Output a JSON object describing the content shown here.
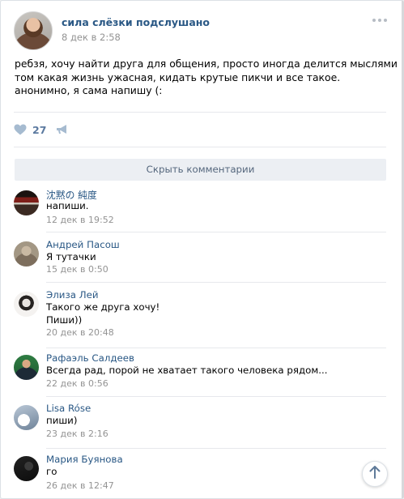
{
  "post": {
    "group_name": "сила слёзки подслушано",
    "date": "8 дек в 2:58",
    "text_lines": [
      "ребзя, хочу найти друга для общения, просто иногда делится мыслями и ныть о",
      "том какая жизнь ужасная, кидать крутые пикчи и все такое.",
      "анонимно, я сама напишу (:"
    ],
    "likes": "27"
  },
  "hide_comments_label": "Скрыть комментарии",
  "comments": [
    {
      "author": "沈黙の 純度",
      "lines": [
        "напиши."
      ],
      "date": "12 дек в 19:52"
    },
    {
      "author": "Андрей Пасош",
      "lines": [
        "Я тутачки"
      ],
      "date": "15 дек в 0:50"
    },
    {
      "author": "Элиза Лей",
      "lines": [
        "Такого же друга хочу!",
        "Пиши))"
      ],
      "date": "20 дек в 20:48"
    },
    {
      "author": "Рафаэль Салдеев",
      "lines": [
        "Всегда рад, порой не хватает такого человека рядом..."
      ],
      "date": "22 дек в 0:56"
    },
    {
      "author": "Lisa Róse",
      "lines": [
        "пиши)"
      ],
      "date": "23 дек в 2:16"
    },
    {
      "author": "Мария Буянова",
      "lines": [
        "го"
      ],
      "date": "26 дек в 12:47"
    }
  ],
  "icons": {
    "more": "more-icon",
    "like": "heart-icon",
    "share": "share-icon",
    "scroll_top": "arrow-up-icon",
    "platform": "apple-icon"
  },
  "colors": {
    "link": "#2a5885",
    "muted": "#939393",
    "like": "#5c7aa0",
    "bar_bg": "#eceff3"
  }
}
